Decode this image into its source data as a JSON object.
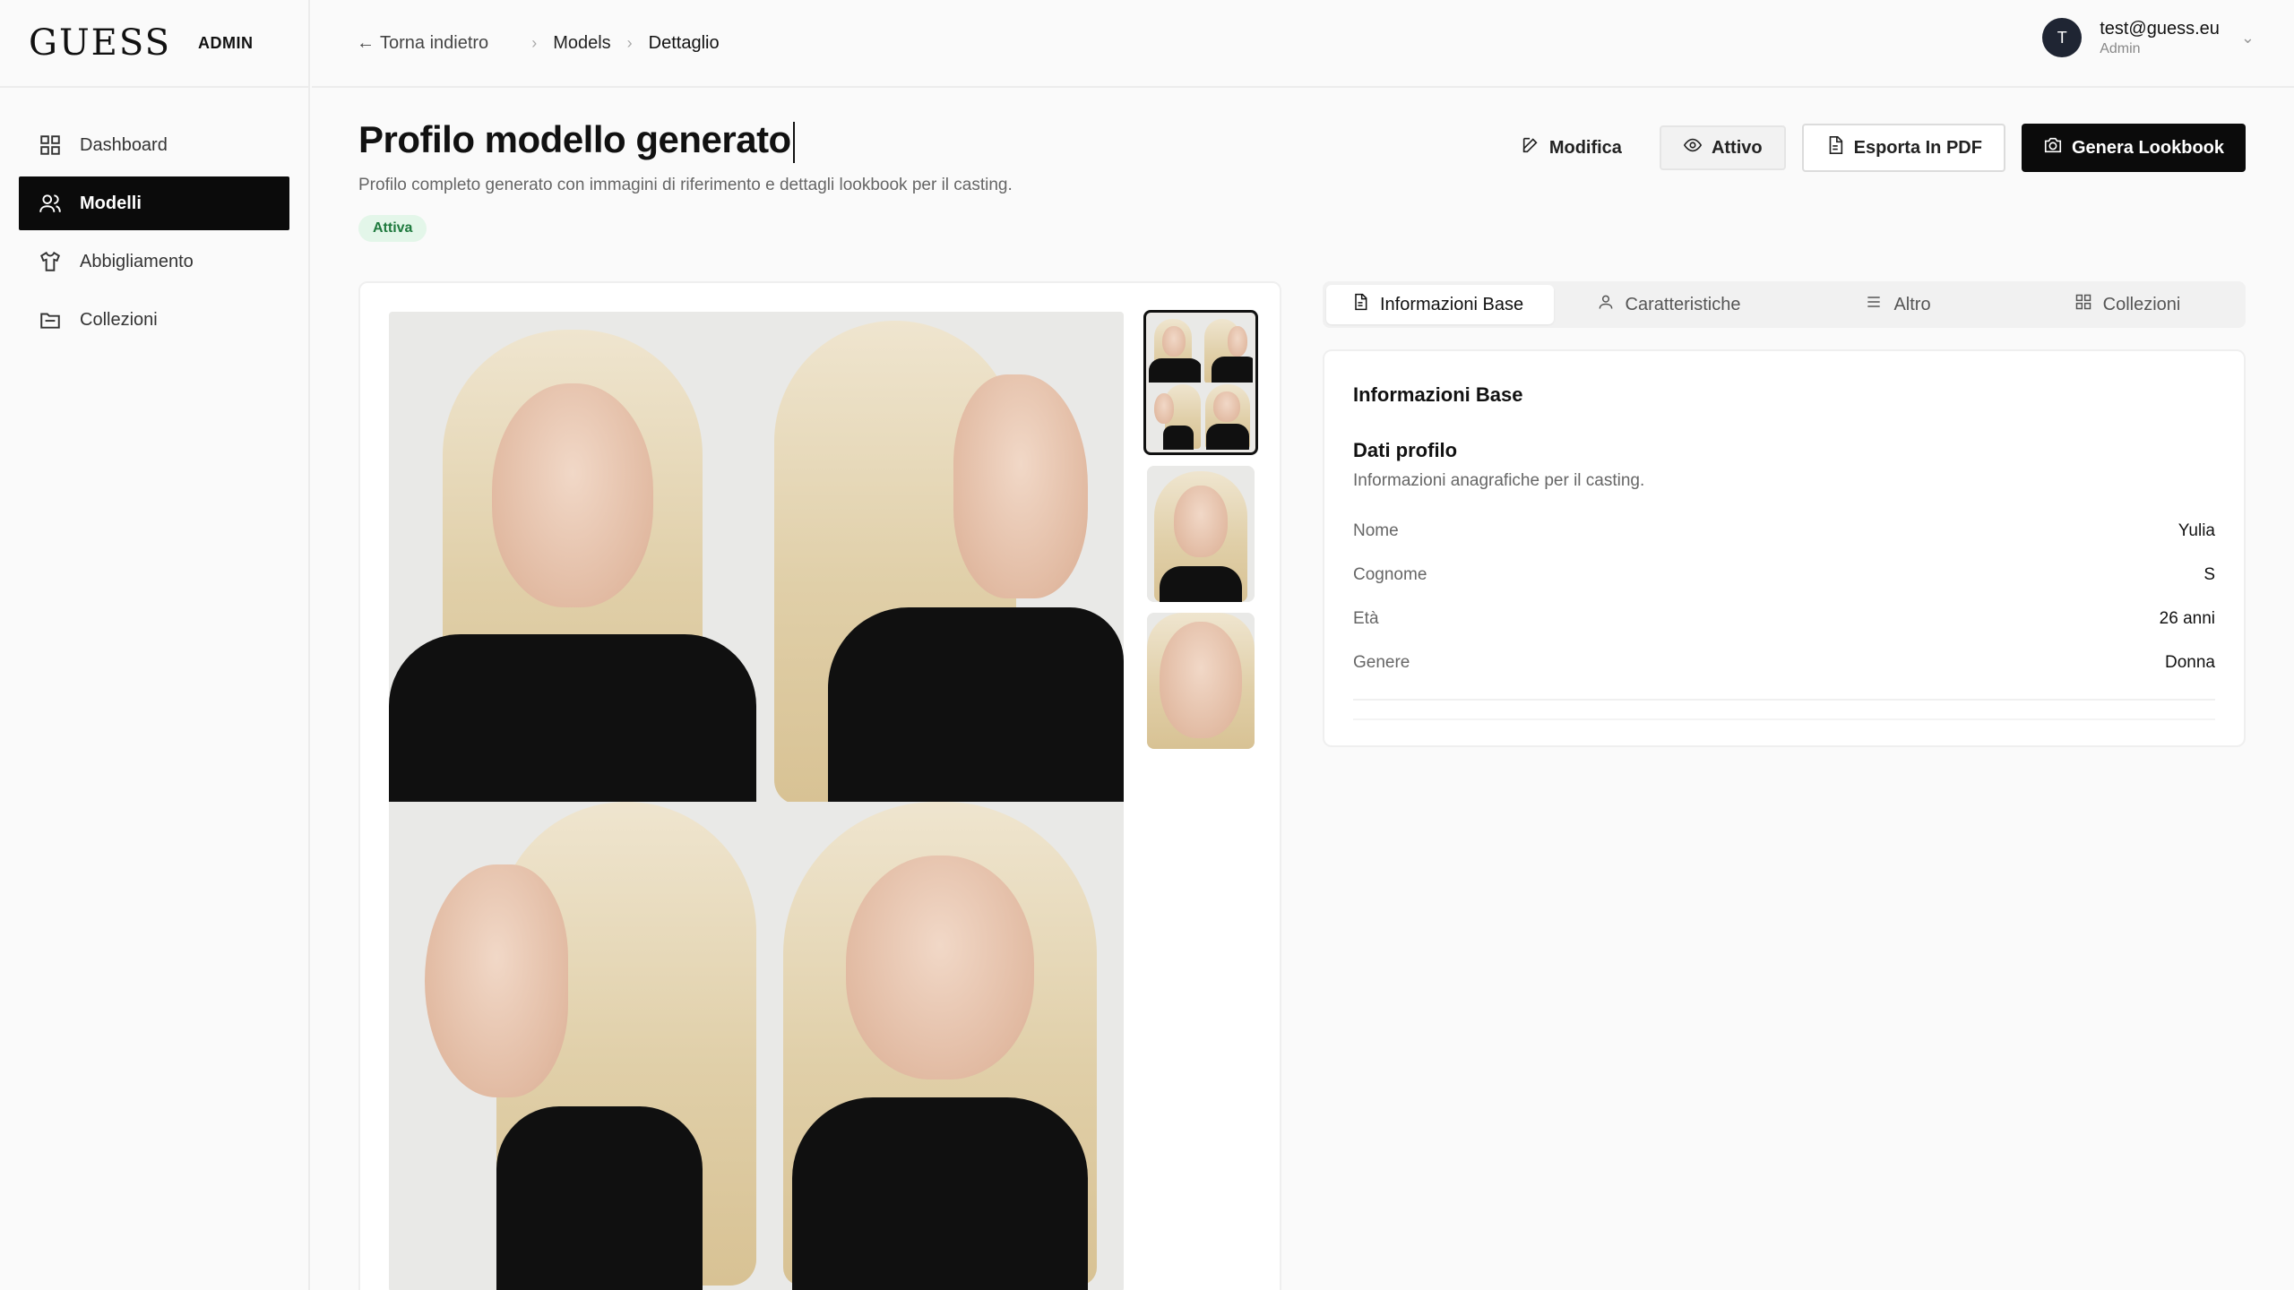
{
  "brand": {
    "logo": "GUESS",
    "section": "ADMIN"
  },
  "sidebar": {
    "items": [
      {
        "label": "Dashboard",
        "icon": "grid-icon"
      },
      {
        "label": "Modelli",
        "icon": "users-icon",
        "active": true
      },
      {
        "label": "Abbigliamento",
        "icon": "shirt-icon"
      },
      {
        "label": "Collezioni",
        "icon": "folder-icon"
      }
    ]
  },
  "topbar": {
    "back": "Torna indietro",
    "crumbs": [
      "Models",
      "Dettaglio"
    ],
    "user": {
      "initial": "T",
      "email": "test@guess.eu",
      "role": "Admin"
    }
  },
  "header": {
    "title": "Profilo modello generato",
    "subtitle": "Profilo completo generato con immagini di riferimento e dettagli lookbook per il casting.",
    "status": "Attiva"
  },
  "actions": {
    "edit": "Modifica",
    "toggle": "Attivo",
    "export": "Esporta In PDF",
    "generate": "Genera Lookbook"
  },
  "tabs": [
    {
      "label": "Informazioni Base",
      "icon": "document-icon",
      "active": true
    },
    {
      "label": "Caratteristiche",
      "icon": "person-icon"
    },
    {
      "label": "Altro",
      "icon": "list-icon"
    },
    {
      "label": "Collezioni",
      "icon": "grid-icon"
    }
  ],
  "info": {
    "title": "Informazioni Base",
    "section_title": "Dati profilo",
    "section_sub": "Informazioni anagrafiche per il casting.",
    "rows": [
      {
        "label": "Nome",
        "value": "Yulia"
      },
      {
        "label": "Cognome",
        "value": "S"
      },
      {
        "label": "Età",
        "value": "26 anni"
      },
      {
        "label": "Genere",
        "value": "Donna"
      }
    ]
  },
  "colors": {
    "accent": "#0b0b0b",
    "status_bg": "#e3f6e9",
    "status_text": "#1f7a3e"
  }
}
